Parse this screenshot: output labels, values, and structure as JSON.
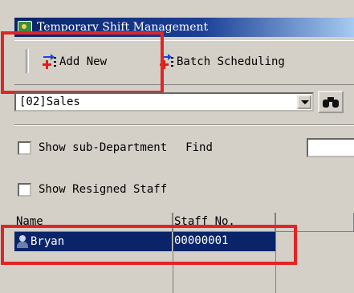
{
  "window": {
    "title": "Temporary Shift Management"
  },
  "toolbar": {
    "add_new_label": "Add New",
    "batch_scheduling_label": "Batch Scheduling"
  },
  "department": {
    "selected": "[02]Sales"
  },
  "filters": {
    "show_sub_department_label": "Show sub-Department",
    "show_sub_department_checked": false,
    "find_label": "Find",
    "find_value": "",
    "show_resigned_label": "Show Resigned Staff",
    "show_resigned_checked": false
  },
  "staff_table": {
    "columns": [
      "Name",
      "Staff No."
    ],
    "rows": [
      {
        "name": "Bryan",
        "staff_no": "00000001",
        "selected": true
      }
    ]
  },
  "colors": {
    "selection": "#0a246a",
    "highlight_box": "#e32424",
    "window_face": "#d4d0c8"
  }
}
